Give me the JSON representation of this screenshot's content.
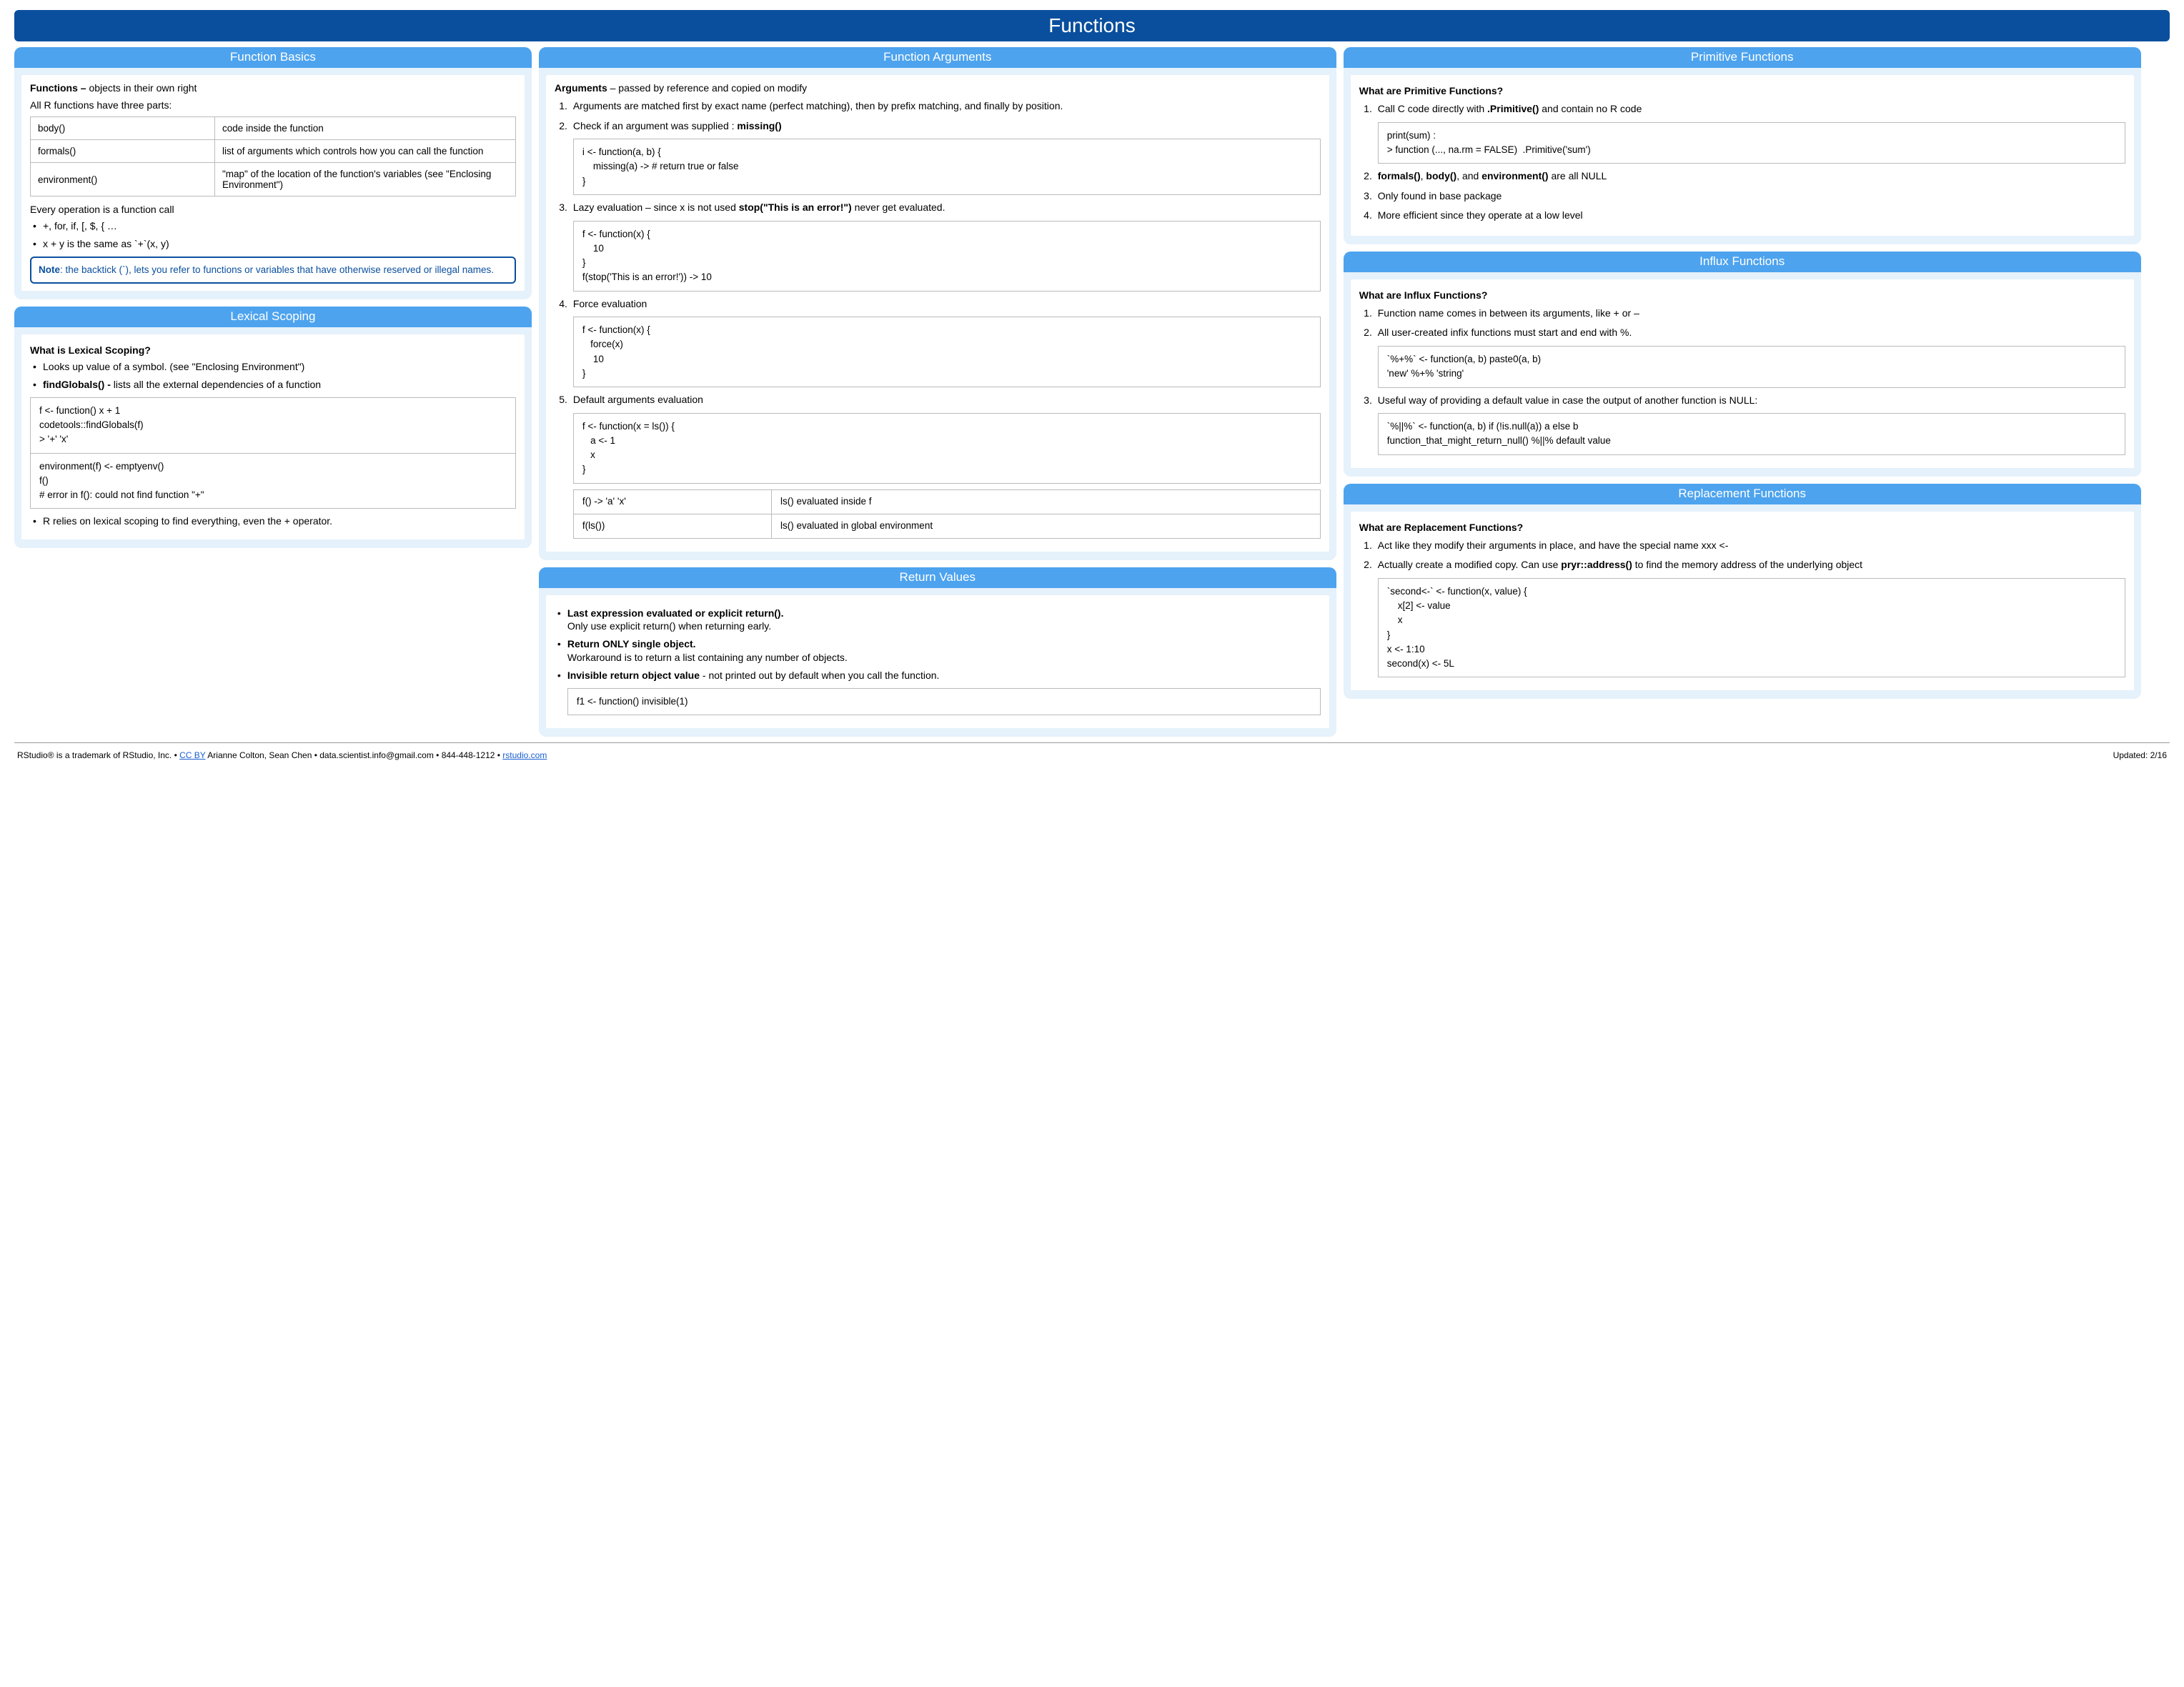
{
  "title": "Functions",
  "basics": {
    "header": "Function Basics",
    "lead_b": "Functions –",
    "lead": " objects in their own right",
    "sub": "All R functions have three parts:",
    "table": [
      {
        "fn": "body()",
        "desc": "code inside the function"
      },
      {
        "fn": "formals()",
        "desc": "list of arguments which controls how you can call the function"
      },
      {
        "fn": "environment()",
        "desc": "\"map\" of the location of the function's variables (see \"Enclosing Environment\")"
      }
    ],
    "every_op": "Every operation is a function call",
    "ops1": "+, for, if, [, $, { …",
    "ops2": "x + y is the same as `+`(x, y)",
    "note_b": "Note",
    "note": ": the backtick (`), lets you refer to functions or variables that have otherwise reserved or illegal names."
  },
  "scoping": {
    "header": "Lexical Scoping",
    "q": "What is Lexical Scoping?",
    "b1": "Looks up value of a symbol. (see \"Enclosing Environment\")",
    "b2_b": "findGlobals() -",
    "b2": " lists all the external dependencies of a function",
    "code1": "f <- function() x + 1\ncodetools::findGlobals(f)\n> '+' 'x'",
    "code2": "environment(f) <- emptyenv()\nf()\n# error in f(): could not find function \"+\"",
    "b3": "R relies on lexical scoping to find everything, even the + operator."
  },
  "args": {
    "header": "Function Arguments",
    "lead_b": "Arguments",
    "lead": " – passed by reference and copied on modify",
    "i1": "Arguments are matched first by exact name (perfect matching), then by prefix matching, and finally by position.",
    "i2_a": "Check if an argument was supplied :  ",
    "i2_b": "missing()",
    "code2": "i <- function(a, b) {\n    missing(a) -> # return true or false\n}",
    "i3_a": "Lazy evaluation – since x is not used ",
    "i3_b": "stop(\"This is an error!\")",
    "i3_c": " never get evaluated.",
    "code3": "f <- function(x) {\n    10\n}\nf(stop('This is an error!')) -> 10",
    "i4": "Force evaluation",
    "code4": "f <- function(x) {\n   force(x)\n    10\n}",
    "i5": "Default arguments evaluation",
    "code5": "f <- function(x = ls()) {\n   a <- 1\n   x\n}",
    "eval": [
      {
        "l": "f() -> 'a' 'x'",
        "r": "ls() evaluated inside f"
      },
      {
        "l": "f(ls())",
        "r": "ls() evaluated in global environment"
      }
    ]
  },
  "ret": {
    "header": "Return Values",
    "b1_b": "Last expression evaluated or explicit return().",
    "b1": " Only use explicit return() when returning early.",
    "b2_b": "Return ONLY single object.",
    "b2": " Workaround is to return a list containing any number of objects.",
    "b3_b": "Invisible return object value",
    "b3": " - not printed out by default  when you call the function.",
    "code": "f1 <- function() invisible(1)"
  },
  "prim": {
    "header": "Primitive Functions",
    "q": "What are Primitive Functions?",
    "i1_a": "Call C code directly with ",
    "i1_b": ".Primitive()",
    "i1_c": " and contain no R code",
    "code1": "print(sum) :\n> function (..., na.rm = FALSE)  .Primitive('sum')",
    "i2_pre": "formals()",
    "i2_b": ", ",
    "i2_mid": "body()",
    "i2_c": ", and ",
    "i2_end": "environment()",
    "i2_tail": " are all NULL",
    "i3": "Only found in base package",
    "i4": "More efficient since they operate at a low level"
  },
  "influx": {
    "header": "Influx Functions",
    "q": "What are Influx Functions?",
    "i1": "Function name comes in between its arguments, like + or –",
    "i2": "All user-created infix functions must start and end with %.",
    "code2": "`%+%` <- function(a, b) paste0(a, b)\n'new' %+% 'string'",
    "i3": "Useful way of providing a default value in case the output of another function is NULL:",
    "code3": "`%||%` <- function(a, b) if (!is.null(a)) a else b\nfunction_that_might_return_null() %||% default value"
  },
  "repl": {
    "header": "Replacement Functions",
    "q": "What are Replacement Functions?",
    "i1": "Act like they modify their arguments in place, and have the special name xxx <-",
    "i2_a": "Actually create a modified copy. Can use ",
    "i2_b": "pryr::address()",
    "i2_c": " to find the memory address of the underlying object",
    "code": "`second<-` <- function(x, value) {\n    x[2] <- value\n    x\n}\nx <- 1:10\nsecond(x) <- 5L"
  },
  "footer": {
    "left_a": "RStudio® is a trademark of RStudio, Inc.  •  ",
    "cc": "CC BY",
    "left_b": "  Arianne Colton, Sean Chen •  data.scientist.info@gmail.com  •  844-448-1212 • ",
    "site": "rstudio.com",
    "right": "Updated: 2/16"
  }
}
